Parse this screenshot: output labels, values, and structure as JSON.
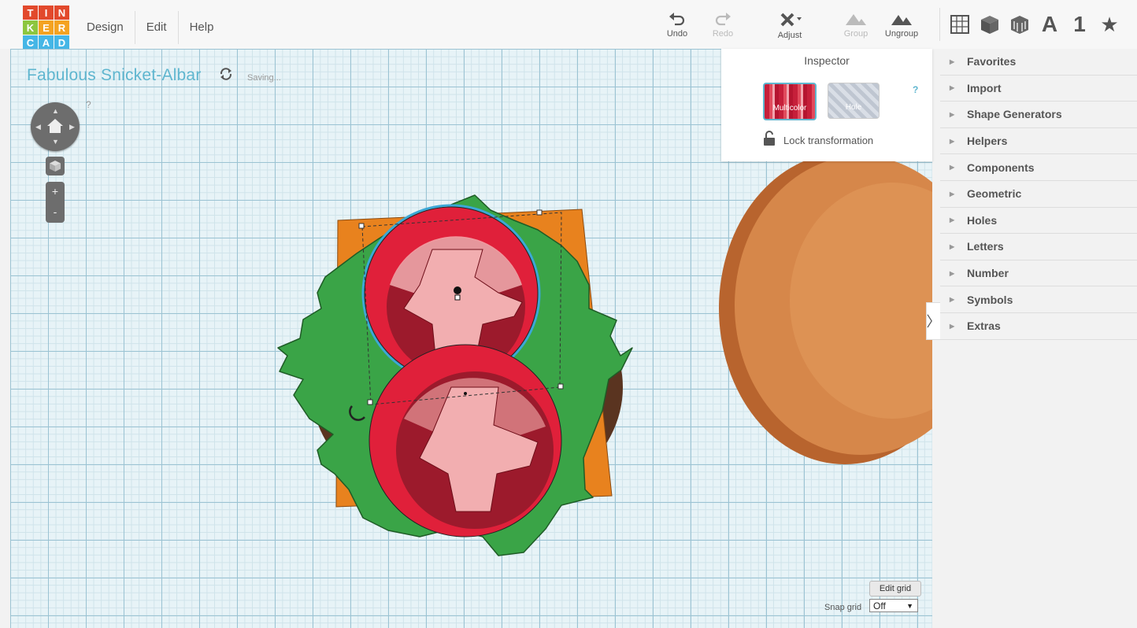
{
  "app": {
    "logo_letters": [
      "T",
      "I",
      "N",
      "K",
      "E",
      "R",
      "C",
      "A",
      "D"
    ],
    "logo_colors": [
      "#e2492c",
      "#e2492c",
      "#e2492c",
      "#8dc63f",
      "#f4a321",
      "#f4a321",
      "#45b6e6",
      "#45b6e6",
      "#45b6e6"
    ]
  },
  "menu": {
    "items": [
      "Design",
      "Edit",
      "Help"
    ]
  },
  "toolbar": {
    "undo": "Undo",
    "redo": "Redo",
    "adjust": "Adjust",
    "group": "Group",
    "ungroup": "Ungroup"
  },
  "view_icons": [
    "grid-view-icon",
    "solid-cube-icon",
    "wire-cube-icon",
    "letter-a-icon",
    "number-one-icon",
    "star-icon"
  ],
  "view_icon_text": {
    "a": "A",
    "one": "1",
    "star": "★"
  },
  "document": {
    "title": "Fabulous Snicket-Albar",
    "status": "Saving..."
  },
  "viewcube": {
    "help": "?",
    "zoom_in": "+",
    "zoom_out": "-"
  },
  "inspector": {
    "title": "Inspector",
    "multicolor_label": "Multicolor",
    "hole_label": "Hole",
    "help": "?",
    "lock_label": "Lock transformation"
  },
  "sidebar": {
    "items": [
      "Favorites",
      "Import",
      "Shape Generators",
      "Helpers",
      "Components",
      "Geometric",
      "Holes",
      "Letters",
      "Number",
      "Symbols",
      "Extras"
    ]
  },
  "grid_controls": {
    "edit_grid": "Edit grid",
    "snap_label": "Snap grid",
    "snap_value": "Off"
  },
  "colors": {
    "accent": "#5fb6cf",
    "object_red": "#e0203a",
    "object_green": "#3aa447",
    "object_orange": "#e8821e",
    "object_pink": "#f2aeb0",
    "bun": "#d9894a"
  }
}
